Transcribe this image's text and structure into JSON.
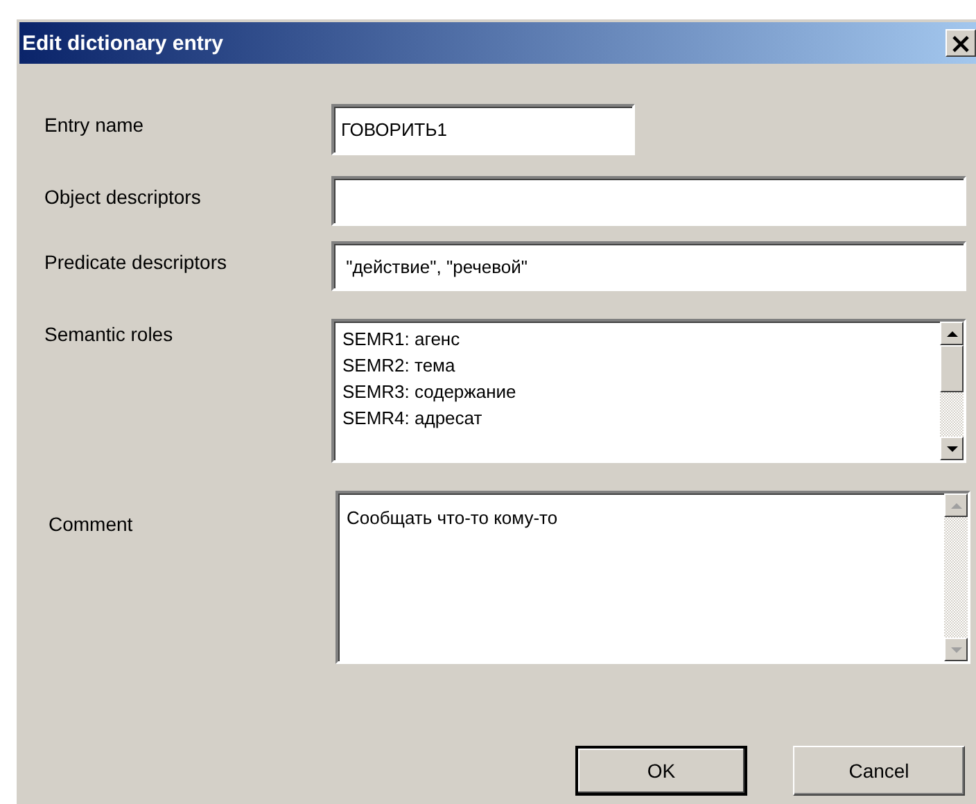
{
  "window": {
    "title": "Edit dictionary entry",
    "close_glyph": "×"
  },
  "fields": [
    {
      "label": "Entry name",
      "value": "ГОВОРИТЬ1",
      "kind": "short"
    },
    {
      "label": "Object descriptors",
      "kind": "wide"
    },
    {
      "label": "Predicate descriptors",
      "value": " \"действие\", \"речевой\"",
      "kind": "wide"
    }
  ],
  "semantic_roles": {
    "label": "Semantic roles",
    "items": [
      "SEMR1: агенс",
      "SEMR2: тема",
      "SEMR3: содержание",
      "SEMR4: адресат"
    ],
    "scrollbar_disabled": false
  },
  "comment": {
    "label": "Comment",
    "value": "Сообщать что-то кому-то",
    "scrollbar_disabled": true
  },
  "buttons": [
    {
      "label": "OK",
      "default": true
    },
    {
      "label": "Cancel",
      "default": false
    }
  ]
}
